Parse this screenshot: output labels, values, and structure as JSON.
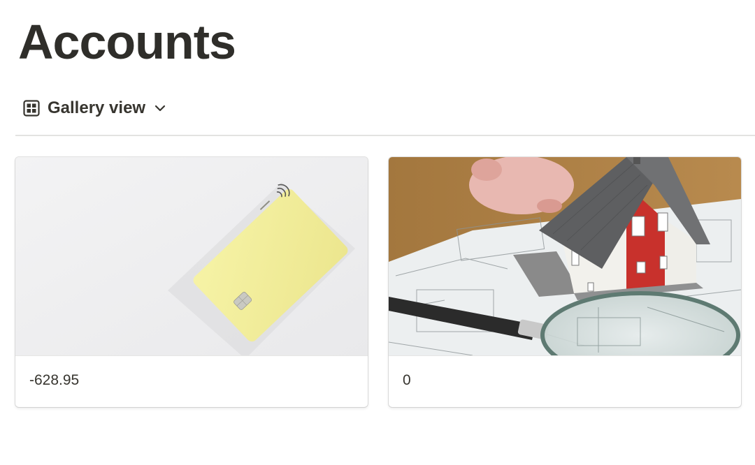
{
  "page": {
    "title": "Accounts"
  },
  "view": {
    "icon": "gallery-grid-icon",
    "label": "Gallery view",
    "dropdown_icon": "chevron-down-icon"
  },
  "cards": [
    {
      "cover": "yellow-credit-card-photo",
      "value": "-628.95"
    },
    {
      "cover": "model-house-with-magnifier-photo",
      "value": "0"
    }
  ],
  "colors": {
    "text": "#37352f",
    "title": "#2f2e2a",
    "divider": "#e3e3e1",
    "card_yellow": "#f0ec9a",
    "house_red": "#c8312c"
  }
}
